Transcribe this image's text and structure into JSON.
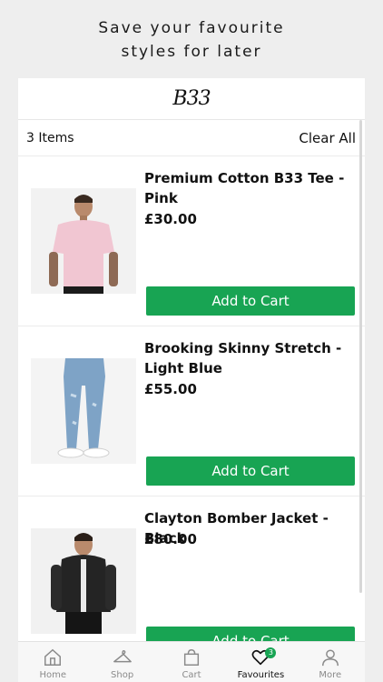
{
  "promo": {
    "line1": "Save your favourite",
    "line2": "styles for later"
  },
  "header": {
    "logo": "B33"
  },
  "list": {
    "count_label": "3 Items",
    "clear_label": "Clear All"
  },
  "products": [
    {
      "name": "Premium Cotton B33 Tee - Pink",
      "price": "£30.00",
      "button": "Add to Cart"
    },
    {
      "name": "Brooking Skinny Stretch - Light Blue",
      "price": "£55.00",
      "button": "Add to Cart"
    },
    {
      "name": "Clayton Bomber Jacket - Black",
      "price": "£80.00",
      "button": "Add to Cart"
    }
  ],
  "tabs": [
    {
      "label": "Home",
      "icon": "home-icon"
    },
    {
      "label": "Shop",
      "icon": "hanger-icon"
    },
    {
      "label": "Cart",
      "icon": "bag-icon"
    },
    {
      "label": "Favourites",
      "icon": "heart-icon",
      "badge": "3",
      "active": true
    },
    {
      "label": "More",
      "icon": "person-icon"
    }
  ],
  "colors": {
    "accent": "#18a453",
    "background": "#eeeeee",
    "tab_inactive": "#8a8a8a"
  }
}
